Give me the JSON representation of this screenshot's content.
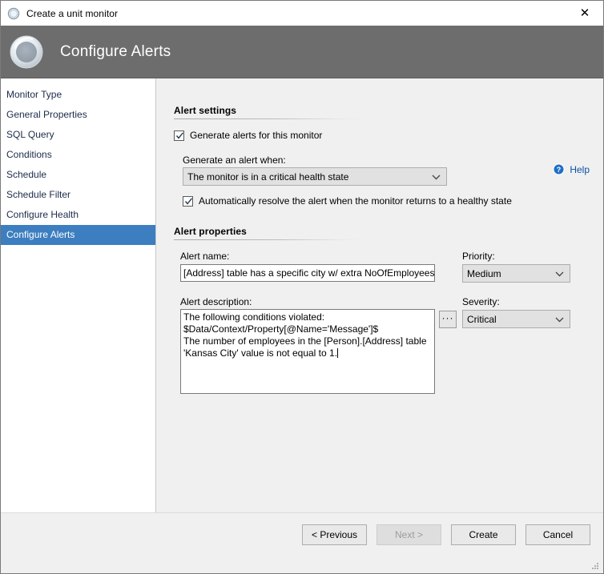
{
  "window": {
    "title": "Create a unit monitor",
    "title_icon": "monitor-circle-icon",
    "close_label": "✕"
  },
  "header": {
    "title": "Configure Alerts",
    "icon": "monitor-ring-icon"
  },
  "sidebar": {
    "items": [
      {
        "label": "Monitor Type",
        "selected": false
      },
      {
        "label": "General Properties",
        "selected": false
      },
      {
        "label": "SQL Query",
        "selected": false
      },
      {
        "label": "Conditions",
        "selected": false
      },
      {
        "label": "Schedule",
        "selected": false
      },
      {
        "label": "Schedule Filter",
        "selected": false
      },
      {
        "label": "Configure Health",
        "selected": false
      },
      {
        "label": "Configure Alerts",
        "selected": true
      }
    ],
    "selected_index": 7,
    "selected_bg": "#3c7ebf"
  },
  "help": {
    "label": "Help",
    "icon": "help-question-icon",
    "color": "#0b4f9c"
  },
  "alert_settings": {
    "section_title": "Alert settings",
    "generate_alerts_checkbox": {
      "label": "Generate alerts for this monitor",
      "checked": true
    },
    "generate_when_label": "Generate an alert when:",
    "generate_when_value": "The monitor is in a critical health state",
    "auto_resolve_checkbox": {
      "label": "Automatically resolve the alert when the monitor returns to a healthy state",
      "checked": true
    }
  },
  "alert_properties": {
    "section_title": "Alert properties",
    "alert_name_label": "Alert name:",
    "alert_name_value": "[Address] table has a specific city w/ extra NoOfEmployees values",
    "alert_description_label": "Alert description:",
    "alert_description_value": "The following conditions violated:\n$Data/Context/Property[@Name='Message']$\nThe number of employees in the [Person].[Address] table 'Kansas City' value is not equal to 1.",
    "browse_button_label": "···",
    "priority_label": "Priority:",
    "priority_value": "Medium",
    "severity_label": "Severity:",
    "severity_value": "Critical"
  },
  "footer": {
    "previous_label": "< Previous",
    "next_label": "Next >",
    "next_disabled": true,
    "create_label": "Create",
    "cancel_label": "Cancel"
  }
}
